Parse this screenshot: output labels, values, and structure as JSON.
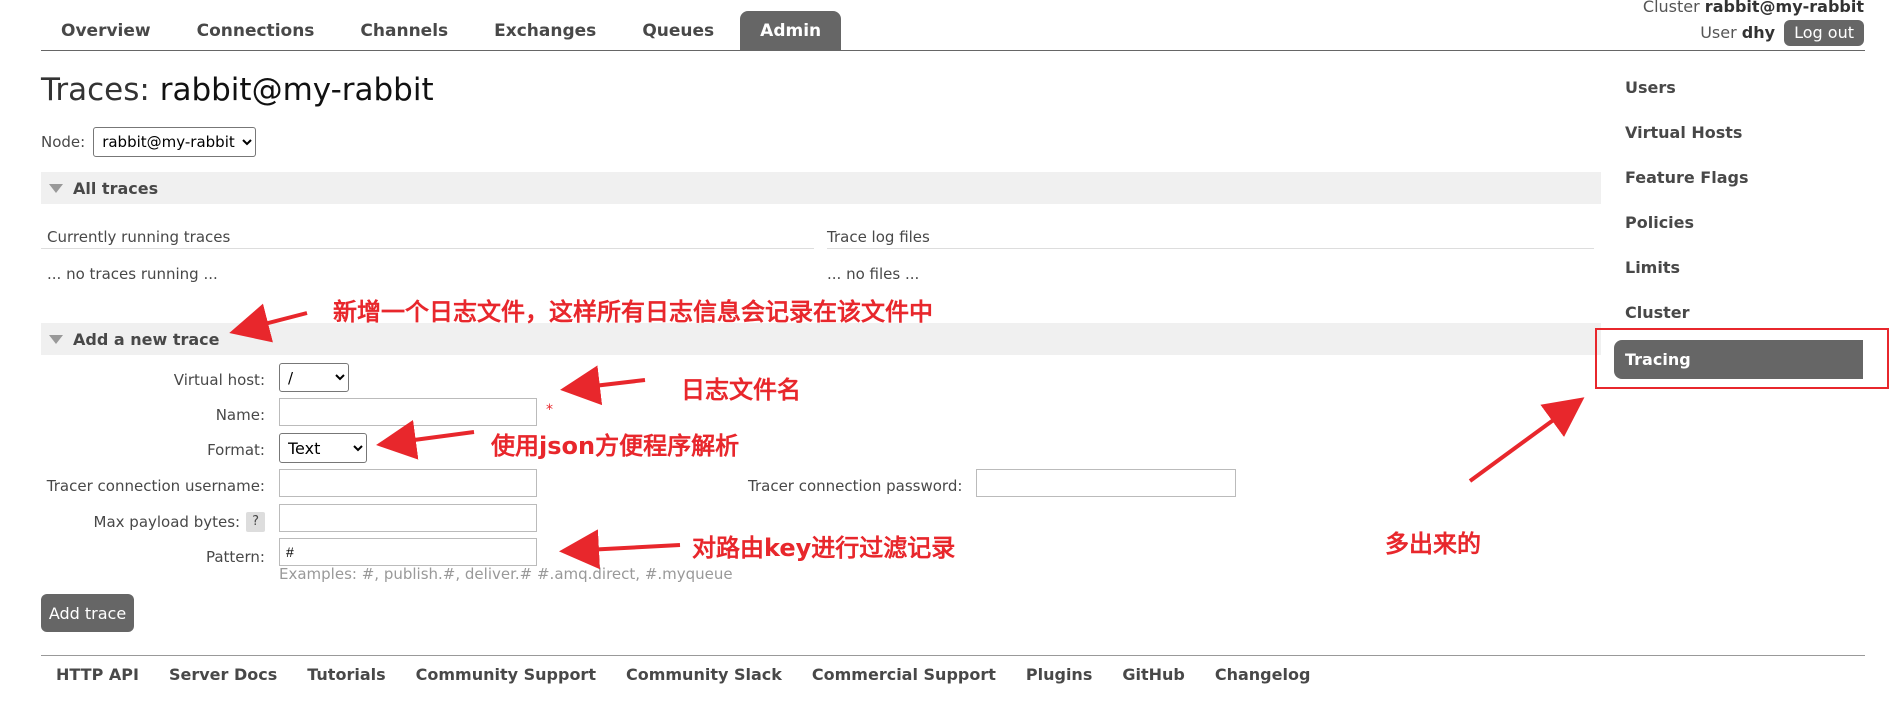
{
  "nav": {
    "tabs": [
      "Overview",
      "Connections",
      "Channels",
      "Exchanges",
      "Queues",
      "Admin"
    ],
    "active": "Admin"
  },
  "header": {
    "cluster_label": "Cluster",
    "cluster_name": "rabbit@my-rabbit",
    "user_label": "User",
    "user_name": "dhy",
    "logout_label": "Log out"
  },
  "page": {
    "title_prefix": "Traces:",
    "title_node": "rabbit@my-rabbit",
    "node_label": "Node:",
    "node_value": "rabbit@my-rabbit"
  },
  "all_traces": {
    "heading": "All traces",
    "running_header": "Currently running traces",
    "running_empty": "... no traces running ...",
    "files_header": "Trace log files",
    "files_empty": "... no files ..."
  },
  "new_trace": {
    "heading": "Add a new trace",
    "vhost_label": "Virtual host:",
    "vhost_value": "/",
    "name_label": "Name:",
    "name_value": "",
    "required_mark": "*",
    "format_label": "Format:",
    "format_value": "Text",
    "username_label": "Tracer connection username:",
    "password_label": "Tracer connection password:",
    "payload_label": "Max payload bytes:",
    "payload_help": "?",
    "pattern_label": "Pattern:",
    "pattern_value": "#",
    "pattern_hint": "Examples: #, publish.#, deliver.# #.amq.direct, #.myqueue",
    "submit_label": "Add trace"
  },
  "sidebar": {
    "items": [
      "Users",
      "Virtual Hosts",
      "Feature Flags",
      "Policies",
      "Limits",
      "Cluster"
    ],
    "active": "Tracing"
  },
  "footer": {
    "links": [
      "HTTP API",
      "Server Docs",
      "Tutorials",
      "Community Support",
      "Community Slack",
      "Commercial Support",
      "Plugins",
      "GitHub",
      "Changelog"
    ]
  },
  "annotations": {
    "add_trace_note": "新增一个日志文件，这样所有日志信息会记录在该文件中",
    "name_note": "日志文件名",
    "format_note": "使用json方便程序解析",
    "pattern_note": "对路由key进行过滤记录",
    "tracing_note": "多出来的",
    "annotation_color": "#e8272c"
  },
  "colors": {
    "accent": "#666666",
    "text": "#484848",
    "section_bg": "#f0f0f0"
  }
}
